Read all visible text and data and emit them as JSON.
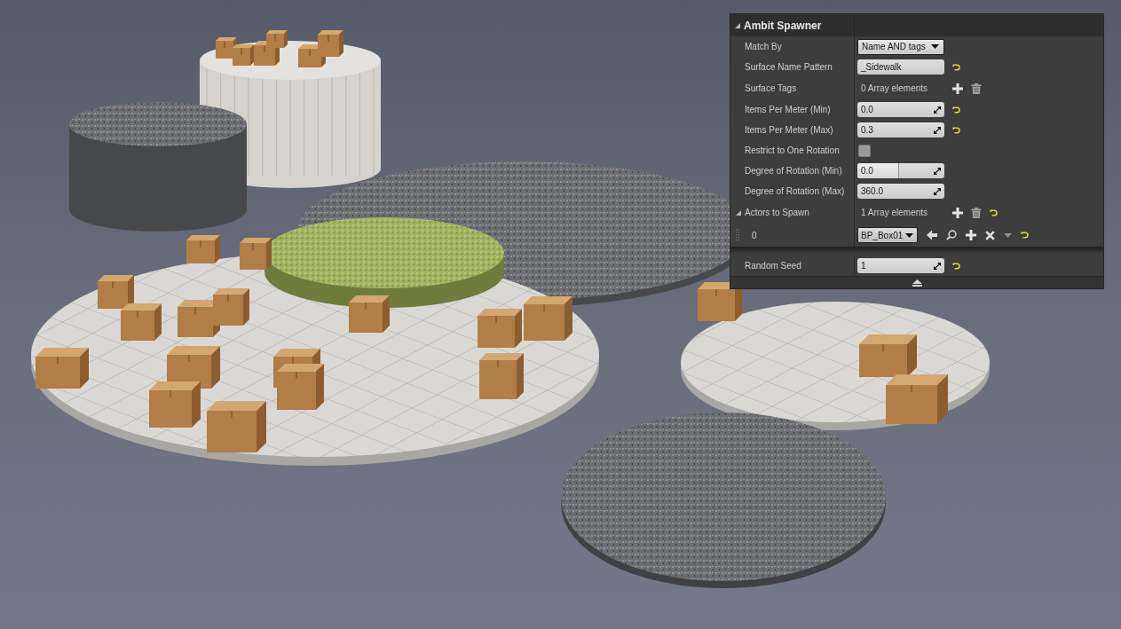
{
  "panel": {
    "title": "Ambit Spawner",
    "expanded": true,
    "sections": [
      {
        "properties": [
          {
            "kind": "dropdown",
            "label": "Match By",
            "value": "Name AND tags",
            "reset": false
          },
          {
            "kind": "text",
            "label": "Surface Name Pattern",
            "value": "_Sidewalk",
            "reset": true
          },
          {
            "kind": "array",
            "label": "Surface Tags",
            "value": "0 Array elements",
            "reset": false
          },
          {
            "kind": "number",
            "label": "Items Per Meter (Min)",
            "value": "0.0",
            "reset": true
          },
          {
            "kind": "number",
            "label": "Items Per Meter (Max)",
            "value": "0.3",
            "reset": true
          },
          {
            "kind": "checkbox",
            "label": "Restrict to One Rotation",
            "checked": false,
            "reset": false
          },
          {
            "kind": "slider",
            "label": "Degree of Rotation (Min)",
            "value": "0.0",
            "level": 0.48,
            "reset": false
          },
          {
            "kind": "number",
            "label": "Degree of Rotation (Max)",
            "value": "360.0",
            "reset": false
          },
          {
            "kind": "array",
            "label": "Actors to Spawn",
            "value": "1 Array elements",
            "reset": true,
            "expanded": true,
            "children": [
              {
                "kind": "asset",
                "label": "0",
                "value": "BP_Box01",
                "reset": true
              }
            ]
          }
        ]
      },
      {
        "properties": [
          {
            "kind": "number",
            "label": "Random Seed",
            "value": "1",
            "reset": true
          }
        ]
      }
    ]
  }
}
